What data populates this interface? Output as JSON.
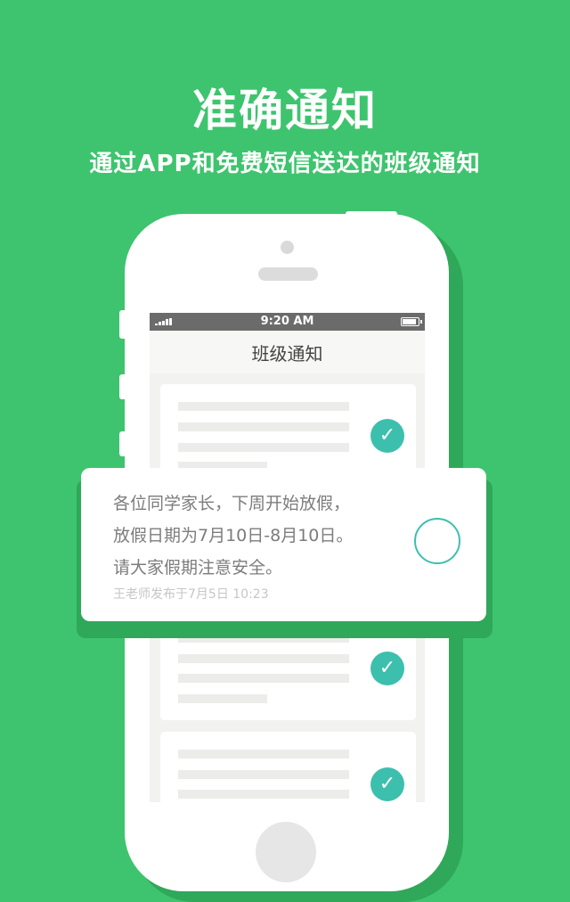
{
  "header": {
    "title": "准确通知",
    "subtitle": "通过APP和免费短信送达的班级通知"
  },
  "phone": {
    "status_time": "9:20 AM",
    "screen_title": "班级通知"
  },
  "notification": {
    "lines": [
      "各位同学家长，下周开始放假，",
      "放假日期为7月10日-8月10日。",
      "请大家假期注意安全。"
    ],
    "meta": "王老师发布于7月5日 10:23"
  },
  "colors": {
    "background": "#3ec46e",
    "accent": "#3dbfae"
  },
  "icons": {
    "check": "check-icon",
    "unchecked": "empty-circle-icon"
  }
}
